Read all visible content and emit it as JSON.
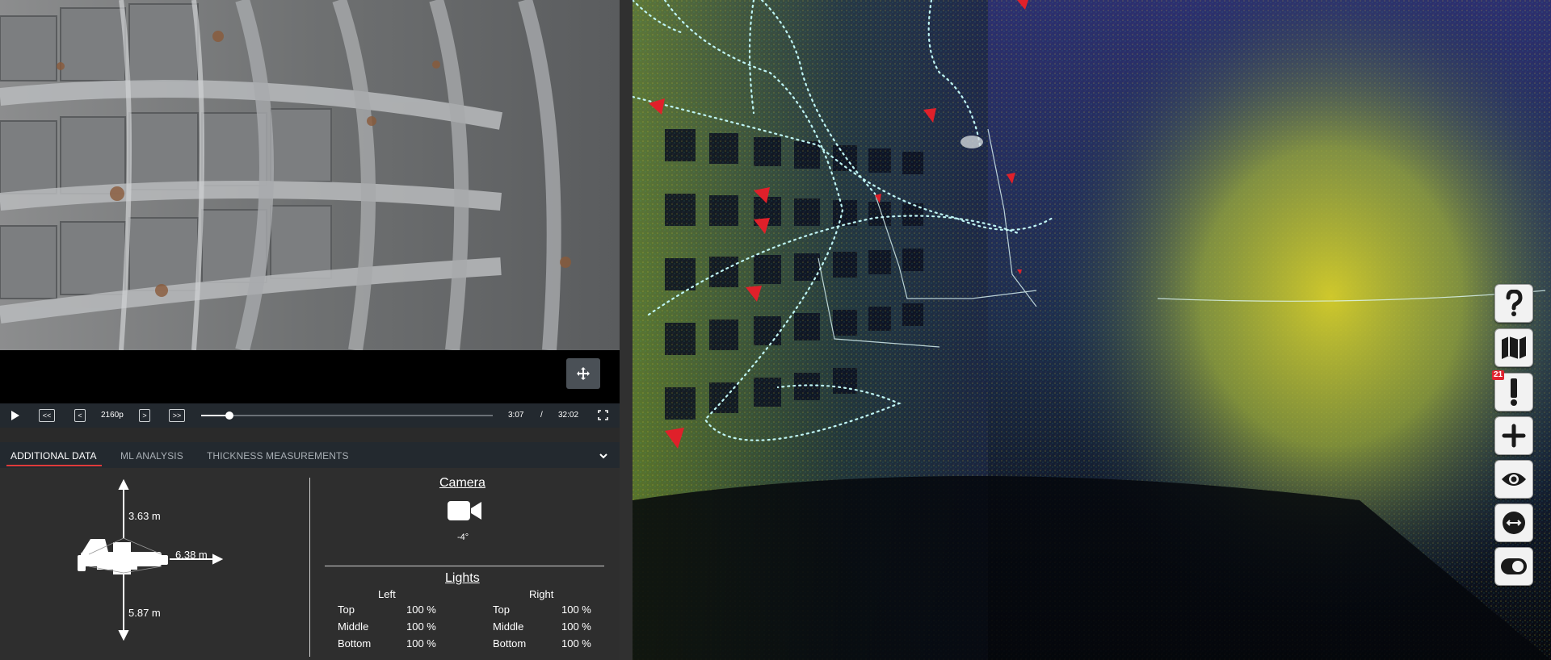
{
  "video": {
    "quality": "2160p",
    "current_time": "3:07",
    "separator": "/",
    "duration": "32:02",
    "progress": 0.097,
    "buttons": {
      "rewind": "<<",
      "prev": "<",
      "next": ">",
      "forward": ">>"
    }
  },
  "tabs": [
    {
      "label": "ADDITIONAL DATA",
      "active": true
    },
    {
      "label": "ML ANALYSIS",
      "active": false
    },
    {
      "label": "THICKNESS MEASUREMENTS",
      "active": false
    }
  ],
  "dimensions": {
    "up": "3.63 m",
    "right": "6.38 m",
    "down": "5.87 m"
  },
  "camera": {
    "title": "Camera",
    "angle": "-4°"
  },
  "lights": {
    "title": "Lights",
    "left_header": "Left",
    "right_header": "Right",
    "left": [
      {
        "name": "Top",
        "value": "100 %"
      },
      {
        "name": "Middle",
        "value": "100 %"
      },
      {
        "name": "Bottom",
        "value": "100 %"
      }
    ],
    "right": [
      {
        "name": "Top",
        "value": "100 %"
      },
      {
        "name": "Middle",
        "value": "100 %"
      },
      {
        "name": "Bottom",
        "value": "100 %"
      }
    ]
  },
  "toolbar": {
    "items": [
      "help-icon",
      "map-icon",
      "alert-icon",
      "plus-icon",
      "eye-icon",
      "range-icon",
      "toggle-icon"
    ],
    "alert_count": "21"
  },
  "colors": {
    "accent_red": "#e03a3a",
    "badge_red": "#e0232f",
    "cloud_yellow": "#e8d83a",
    "cloud_teal": "#3fa0a0",
    "cloud_purple": "#3a3a7a",
    "path_cyan": "#bff4f4"
  }
}
